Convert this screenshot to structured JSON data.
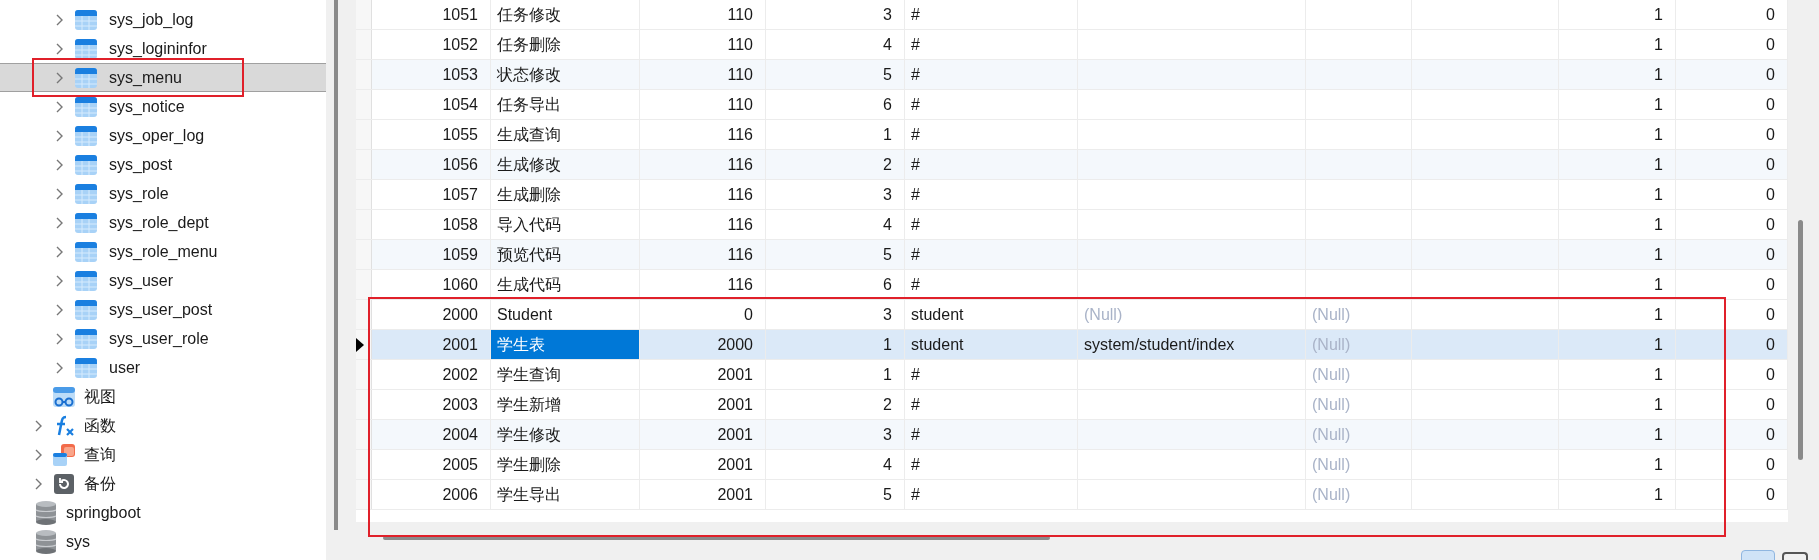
{
  "sidebar": {
    "tables": [
      {
        "label": "sys_job_log",
        "selected": false
      },
      {
        "label": "sys_logininfor",
        "selected": false
      },
      {
        "label": "sys_menu",
        "selected": true
      },
      {
        "label": "sys_notice",
        "selected": false
      },
      {
        "label": "sys_oper_log",
        "selected": false
      },
      {
        "label": "sys_post",
        "selected": false
      },
      {
        "label": "sys_role",
        "selected": false
      },
      {
        "label": "sys_role_dept",
        "selected": false
      },
      {
        "label": "sys_role_menu",
        "selected": false
      },
      {
        "label": "sys_user",
        "selected": false
      },
      {
        "label": "sys_user_post",
        "selected": false
      },
      {
        "label": "sys_user_role",
        "selected": false
      },
      {
        "label": "user",
        "selected": false
      }
    ],
    "objects": [
      {
        "kind": "view",
        "label": "视图"
      },
      {
        "kind": "function",
        "label": "函数"
      },
      {
        "kind": "query",
        "label": "查询"
      },
      {
        "kind": "backup",
        "label": "备份"
      }
    ],
    "databases": [
      {
        "label": "springboot"
      },
      {
        "label": "sys"
      }
    ]
  },
  "table": {
    "rows": [
      {
        "selected": false,
        "cells": [
          "1051",
          "任务修改",
          "110",
          "3",
          "#",
          null,
          null,
          null,
          "1",
          "0"
        ]
      },
      {
        "selected": false,
        "cells": [
          "1052",
          "任务删除",
          "110",
          "4",
          "#",
          null,
          null,
          null,
          "1",
          "0"
        ]
      },
      {
        "selected": false,
        "cells": [
          "1053",
          "状态修改",
          "110",
          "5",
          "#",
          null,
          null,
          null,
          "1",
          "0"
        ]
      },
      {
        "selected": false,
        "cells": [
          "1054",
          "任务导出",
          "110",
          "6",
          "#",
          null,
          null,
          null,
          "1",
          "0"
        ]
      },
      {
        "selected": false,
        "cells": [
          "1055",
          "生成查询",
          "116",
          "1",
          "#",
          null,
          null,
          null,
          "1",
          "0"
        ]
      },
      {
        "selected": false,
        "cells": [
          "1056",
          "生成修改",
          "116",
          "2",
          "#",
          null,
          null,
          null,
          "1",
          "0"
        ]
      },
      {
        "selected": false,
        "cells": [
          "1057",
          "生成删除",
          "116",
          "3",
          "#",
          null,
          null,
          null,
          "1",
          "0"
        ]
      },
      {
        "selected": false,
        "cells": [
          "1058",
          "导入代码",
          "116",
          "4",
          "#",
          null,
          null,
          null,
          "1",
          "0"
        ]
      },
      {
        "selected": false,
        "cells": [
          "1059",
          "预览代码",
          "116",
          "5",
          "#",
          null,
          null,
          null,
          "1",
          "0"
        ]
      },
      {
        "selected": false,
        "cells": [
          "1060",
          "生成代码",
          "116",
          "6",
          "#",
          null,
          null,
          null,
          "1",
          "0"
        ]
      },
      {
        "selected": false,
        "cells": [
          "2000",
          "Student",
          "0",
          "3",
          "student",
          {
            "text": "(Null)",
            "null": true
          },
          {
            "text": "(Null)",
            "null": true
          },
          null,
          "1",
          "0"
        ]
      },
      {
        "selected": true,
        "cells": [
          "2001",
          {
            "text": "学生表",
            "focused": true
          },
          "2000",
          "1",
          "student",
          "system/student/index",
          {
            "text": "(Null)",
            "null": true
          },
          null,
          "1",
          "0"
        ]
      },
      {
        "selected": false,
        "cells": [
          "2002",
          "学生查询",
          "2001",
          "1",
          "#",
          null,
          {
            "text": "(Null)",
            "null": true
          },
          null,
          "1",
          "0"
        ]
      },
      {
        "selected": false,
        "cells": [
          "2003",
          "学生新增",
          "2001",
          "2",
          "#",
          null,
          {
            "text": "(Null)",
            "null": true
          },
          null,
          "1",
          "0"
        ]
      },
      {
        "selected": false,
        "cells": [
          "2004",
          "学生修改",
          "2001",
          "3",
          "#",
          null,
          {
            "text": "(Null)",
            "null": true
          },
          null,
          "1",
          "0"
        ]
      },
      {
        "selected": false,
        "cells": [
          "2005",
          "学生删除",
          "2001",
          "4",
          "#",
          null,
          {
            "text": "(Null)",
            "null": true
          },
          null,
          "1",
          "0"
        ]
      },
      {
        "selected": false,
        "cells": [
          "2006",
          "学生导出",
          "2001",
          "5",
          "#",
          null,
          {
            "text": "(Null)",
            "null": true
          },
          null,
          "1",
          "0"
        ]
      }
    ]
  }
}
